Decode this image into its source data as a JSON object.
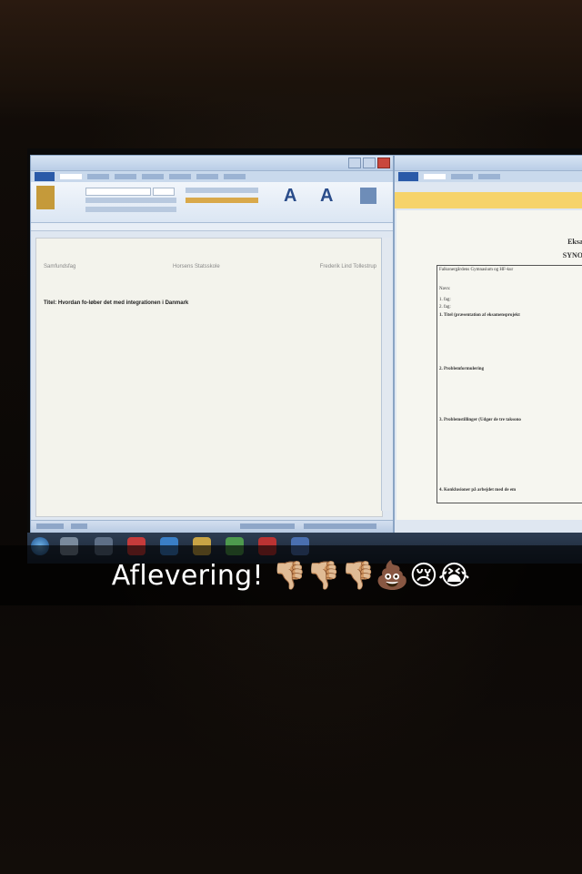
{
  "caption": {
    "text": "Aflevering! 👎🏼👎🏼👎🏼💩😢😭"
  },
  "word_window": {
    "document_header_left": "Samfundsfag",
    "document_header_center": "Horsens Statsskole",
    "document_header_right": "Frederik Lind Tollestrup",
    "document_title_line": "Titel: Hvordan fo-løber det med integrationen i Danmark"
  },
  "pdf_window": {
    "heading_1": "Eksa",
    "heading_2": "SYNO",
    "line_1": "Falkonergårdens Gymnasium og HF-kur",
    "line_2": "Navn:",
    "line_3": "1. fag:",
    "line_4": "2. fag:",
    "line_5": "1. Titel (præsentation af eksamensprojekt",
    "line_6": "2. Problemformulering",
    "line_7": "3. Problemstillinger (Udgør de tre taksono",
    "line_8": "4. Konklusioner på arbejdet med de em"
  },
  "colors": {
    "background": "#0e0a07",
    "caption_bar": "rgba(0,0,0,0.62)",
    "caption_text": "#ffffff",
    "word_ribbon": "#dbe6f3",
    "pdf_banner": "#f6d36a"
  }
}
